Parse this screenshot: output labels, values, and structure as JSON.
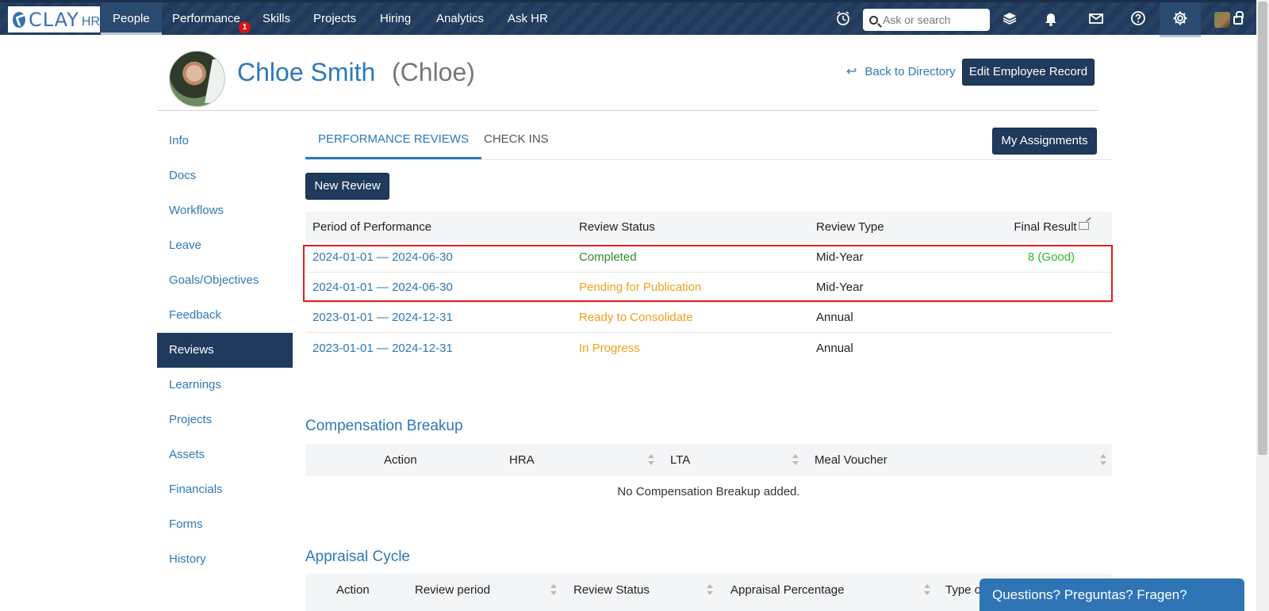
{
  "nav": {
    "logo_main": "CLAY",
    "logo_sub": "HR",
    "items": [
      "People",
      "Performance",
      "Skills",
      "Projects",
      "Hiring",
      "Analytics",
      "Ask HR"
    ],
    "performance_badge": "1",
    "search_placeholder": "Ask or search"
  },
  "header": {
    "name": "Chloe Smith",
    "nickname": "(Chloe)",
    "back_link": "Back to Directory",
    "edit_button": "Edit Employee Record"
  },
  "sidebar": {
    "items": [
      "Info",
      "Docs",
      "Workflows",
      "Leave",
      "Goals/Objectives",
      "Feedback",
      "Reviews",
      "Learnings",
      "Projects",
      "Assets",
      "Financials",
      "Forms",
      "History"
    ],
    "active": "Reviews"
  },
  "tabs": {
    "performance_reviews": "PERFORMANCE REVIEWS",
    "check_ins": "CHECK INS",
    "my_assignments": "My Assignments"
  },
  "reviews": {
    "new_button": "New Review",
    "columns": [
      "Period of Performance",
      "Review Status",
      "Review Type",
      "Final Result"
    ],
    "rows": [
      {
        "period": "2024-01-01 — 2024-06-30",
        "status": "Completed",
        "type": "Mid-Year",
        "result": "8 (Good)"
      },
      {
        "period": "2024-01-01 — 2024-06-30",
        "status": "Pending for Publication",
        "type": "Mid-Year",
        "result": ""
      },
      {
        "period": "2023-01-01 — 2024-12-31",
        "status": "Ready to Consolidate",
        "type": "Annual",
        "result": ""
      },
      {
        "period": "2023-01-01 — 2024-12-31",
        "status": "In Progress",
        "type": "Annual",
        "result": ""
      }
    ]
  },
  "compensation": {
    "title": "Compensation Breakup",
    "columns": [
      "Action",
      "HRA",
      "LTA",
      "Meal Voucher"
    ],
    "empty": "No Compensation Breakup added."
  },
  "appraisal": {
    "title": "Appraisal Cycle",
    "columns": [
      "Action",
      "Review period",
      "Review Status",
      "Appraisal Percentage",
      "Type of"
    ]
  },
  "help_bar": "Questions? Preguntas? Fragen?",
  "colors": {
    "nav_bg": "#1f3a5c",
    "link": "#2d79b7",
    "status_completed": "#2e8b2e",
    "status_pending": "#f0a01c",
    "highlight": "#e41c1c"
  },
  "icons": [
    "alarm-clock-icon",
    "search-icon",
    "layers-icon",
    "bell-icon",
    "mail-icon",
    "help-icon",
    "gear-icon",
    "lock-icon",
    "back-arrow-icon",
    "external-link-icon",
    "sort-icon"
  ]
}
